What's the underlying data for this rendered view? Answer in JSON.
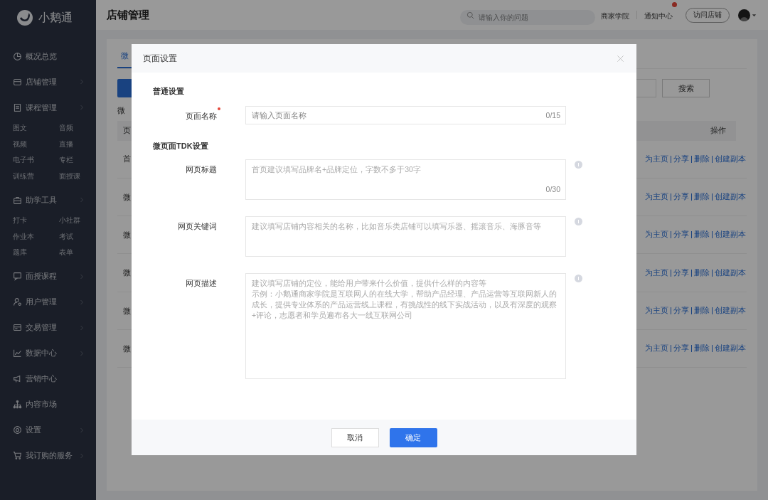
{
  "sidebar": {
    "logo": "小鹅通",
    "items": [
      {
        "label": "概况总览",
        "expandable": false
      },
      {
        "label": "店铺管理",
        "expandable": true
      },
      {
        "label": "课程管理",
        "expandable": true,
        "children": [
          "图文",
          "音频",
          "视频",
          "直播",
          "电子书",
          "专栏",
          "训练营",
          "面授课"
        ]
      },
      {
        "label": "助学工具",
        "expandable": true,
        "children": [
          "打卡",
          "小社群",
          "作业本",
          "考试",
          "题库",
          "表单"
        ]
      },
      {
        "label": "面授课程",
        "expandable": true
      },
      {
        "label": "用户管理",
        "expandable": true
      },
      {
        "label": "交易管理",
        "expandable": true
      },
      {
        "label": "数据中心",
        "expandable": true
      },
      {
        "label": "营销中心",
        "expandable": false
      },
      {
        "label": "内容市场",
        "expandable": false
      },
      {
        "label": "设置",
        "expandable": true
      },
      {
        "label": "我订购的服务",
        "expandable": true
      }
    ]
  },
  "header": {
    "title": "店铺管理",
    "search": {
      "placeholder": "请输入你的问题"
    },
    "links": [
      "商家学院",
      "通知中心"
    ],
    "notification_dot": true,
    "visit_button": "访问店铺"
  },
  "page": {
    "tab": "微",
    "list_caption": "微",
    "search_button": "搜索",
    "table": {
      "column_1": "页",
      "actions_header": "操作",
      "rows": [
        {
          "name": "首",
          "actions": [
            "为主页",
            "分享",
            "删除",
            "创建副本"
          ]
        },
        {
          "name": "微",
          "actions": [
            "为主页",
            "分享",
            "删除",
            "创建副本"
          ]
        },
        {
          "name": "微",
          "actions": [
            "为主页",
            "分享",
            "删除",
            "创建副本"
          ]
        },
        {
          "name": "微",
          "actions": [
            "为主页",
            "分享",
            "删除",
            "创建副本"
          ]
        },
        {
          "name": "微",
          "actions": [
            "为主页",
            "分享",
            "删除",
            "创建副本"
          ]
        },
        {
          "name": "微",
          "actions": [
            "为主页",
            "分享",
            "删除",
            "创建副本"
          ]
        }
      ]
    }
  },
  "dialog": {
    "title": "页面设置",
    "sections": [
      {
        "heading": "普通设置",
        "fields": [
          {
            "kind": "input",
            "label": "页面名称",
            "required": true,
            "placeholder": "请输入页面名称",
            "counter": "0/15",
            "info": false
          }
        ]
      },
      {
        "heading": "微页面TDK设置",
        "fields": [
          {
            "kind": "textarea",
            "label": "网页标题",
            "required": false,
            "placeholder": "首页建议填写品牌名+品牌定位，字数不多于30字",
            "counter": "0/30",
            "info": true
          },
          {
            "kind": "textarea",
            "label": "网页关键词",
            "required": false,
            "placeholder": "建议填写店铺内容相关的名称，比如音乐类店铺可以填写乐器、摇滚音乐、海豚音等",
            "info": true
          },
          {
            "kind": "large_textarea",
            "label": "网页描述",
            "required": false,
            "placeholder": [
              "建议填写店铺的定位，能给用户带来什么价值，提供什么样的内容等",
              "示例：小鹅通商家学院是互联网人的在线大学，帮助产品经理、产品运营等互联网新人的成长，提供专业体系的产品运营线上课程，有挑战性的线下实战活动，以及有深度的观察+评论，志愿者和学员遍布各大一线互联网公司"
            ],
            "info": true
          }
        ]
      }
    ],
    "cancel": "取消",
    "confirm": "确定"
  }
}
